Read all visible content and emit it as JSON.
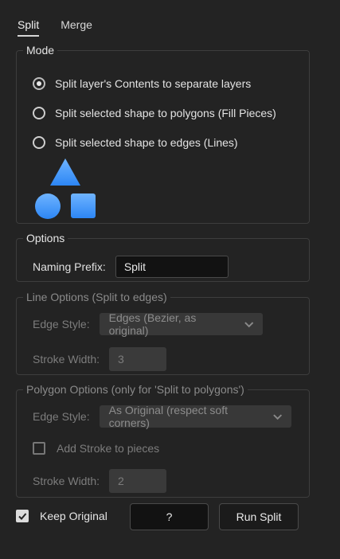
{
  "tabs": [
    {
      "label": "Split",
      "active": true
    },
    {
      "label": "Merge",
      "active": false
    }
  ],
  "mode": {
    "legend": "Mode",
    "options": [
      {
        "label": "Split layer's Contents to separate layers",
        "checked": true
      },
      {
        "label": "Split selected shape to polygons (Fill Pieces)",
        "checked": false
      },
      {
        "label": "Split selected shape to edges (Lines)",
        "checked": false
      }
    ],
    "shape_color": "#4a9dff",
    "icon_names": [
      "triangle-shape-icon",
      "circle-shape-icon",
      "square-shape-icon"
    ]
  },
  "options": {
    "legend": "Options",
    "naming_prefix_label": "Naming Prefix:",
    "naming_prefix_value": "Split"
  },
  "line_options": {
    "legend": "Line Options (Split to edges)",
    "edge_style_label": "Edge Style:",
    "edge_style_value": "Edges (Bezier, as original)",
    "stroke_width_label": "Stroke Width:",
    "stroke_width_value": "3"
  },
  "polygon_options": {
    "legend": "Polygon Options (only for 'Split to polygons')",
    "edge_style_label": "Edge Style:",
    "edge_style_value": "As Original (respect soft corners)",
    "add_stroke_label": "Add Stroke to pieces",
    "add_stroke_checked": false,
    "stroke_width_label": "Stroke Width:",
    "stroke_width_value": "2"
  },
  "footer": {
    "keep_original_label": "Keep Original",
    "keep_original_checked": true,
    "help_label": "?",
    "run_label": "Run Split"
  }
}
